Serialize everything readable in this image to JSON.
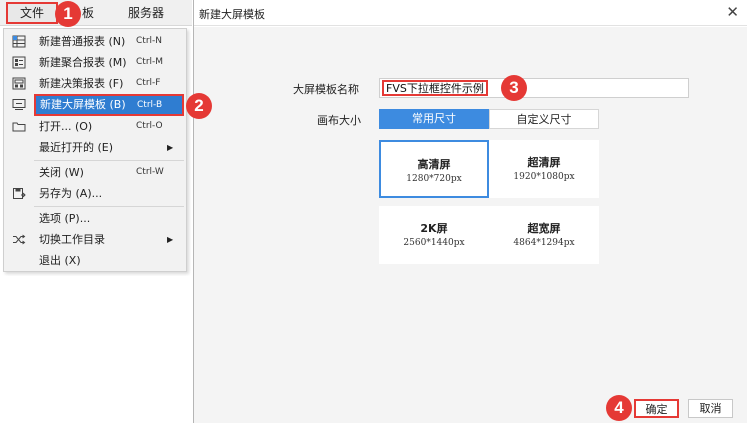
{
  "menubar": {
    "file": "文件",
    "template_partial": "板",
    "server": "服务器"
  },
  "file_menu": {
    "items": [
      {
        "label": "新建普通报表 (N)",
        "shortcut": "Ctrl-N"
      },
      {
        "label": "新建聚合报表 (M)",
        "shortcut": "Ctrl-M"
      },
      {
        "label": "新建决策报表 (F)",
        "shortcut": "Ctrl-F"
      },
      {
        "label": "新建大屏模板 (B)",
        "shortcut": "Ctrl-B"
      },
      {
        "label": "打开... (O)",
        "shortcut": "Ctrl-O"
      },
      {
        "label": "最近打开的 (E)",
        "shortcut": ""
      },
      {
        "label": "关闭 (W)",
        "shortcut": "Ctrl-W"
      },
      {
        "label": "另存为 (A)...",
        "shortcut": ""
      },
      {
        "label": "选项 (P)...",
        "shortcut": ""
      },
      {
        "label": "切换工作目录",
        "shortcut": ""
      },
      {
        "label": "退出 (X)",
        "shortcut": ""
      }
    ]
  },
  "badges": [
    "1",
    "2",
    "3",
    "4"
  ],
  "dialog": {
    "title": "新建大屏模板",
    "close": "✕",
    "name_label": "大屏模板名称",
    "name_value": "FVS下拉框控件示例",
    "canvas_label": "画布大小",
    "tabs": {
      "common": "常用尺寸",
      "custom": "自定义尺寸"
    },
    "sizes": [
      {
        "name": "高清屏",
        "dim": "1280*720px"
      },
      {
        "name": "超清屏",
        "dim": "1920*1080px"
      },
      {
        "name": "2K屏",
        "dim": "2560*1440px"
      },
      {
        "name": "超宽屏",
        "dim": "4864*1294px"
      }
    ],
    "ok": "确定",
    "cancel": "取消"
  },
  "colors": {
    "accent": "#3d8be0",
    "highlight": "#e53935",
    "menu_active": "#2f7dd1"
  }
}
